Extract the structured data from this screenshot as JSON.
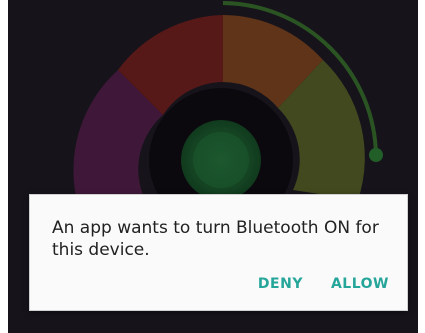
{
  "background": {
    "ring_colors": [
      "#7b2d6e",
      "#b0302a",
      "#c46a2c",
      "#8a9a3a",
      "#4a8a4a"
    ],
    "center_color": "#2e8b4a",
    "knob_color": "#3aa356"
  },
  "dialog": {
    "message": "An app wants to turn Bluetooth ON for this device.",
    "deny_label": "DENY",
    "allow_label": "ALLOW",
    "accent_color": "#26a69a"
  }
}
